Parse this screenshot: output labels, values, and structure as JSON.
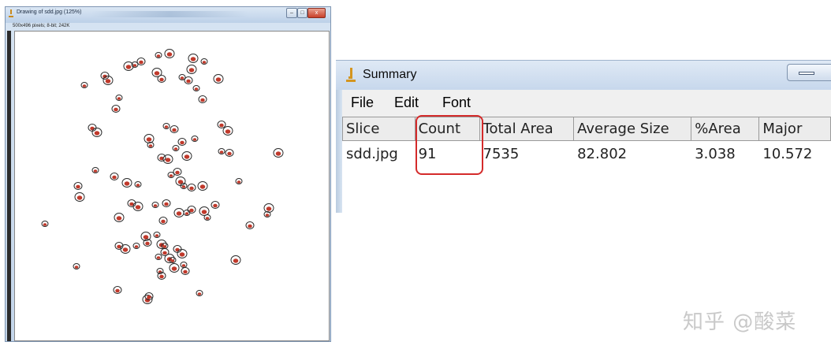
{
  "drawing_window": {
    "title": "Drawing of sdd.jpg (125%)",
    "info": "500x496 pixels; 8-bit; 242K",
    "ctrl_minimize": "–",
    "ctrl_maximize": "□",
    "ctrl_close": "x"
  },
  "summary_window": {
    "title": "Summary",
    "menu": [
      "File",
      "Edit",
      "Font"
    ],
    "columns": [
      "Slice",
      "Count",
      "Total Area",
      "Average Size",
      "%Area",
      "Major"
    ],
    "rows": [
      [
        "sdd.jpg",
        "91",
        "7535",
        "82.802",
        "3.038",
        "10.572"
      ]
    ]
  },
  "watermark": "知乎 @酸菜",
  "colors": {
    "highlight": "#d42a2a",
    "particle_outline": "#2a2a2a",
    "particle_fill": "#c0392b"
  }
}
